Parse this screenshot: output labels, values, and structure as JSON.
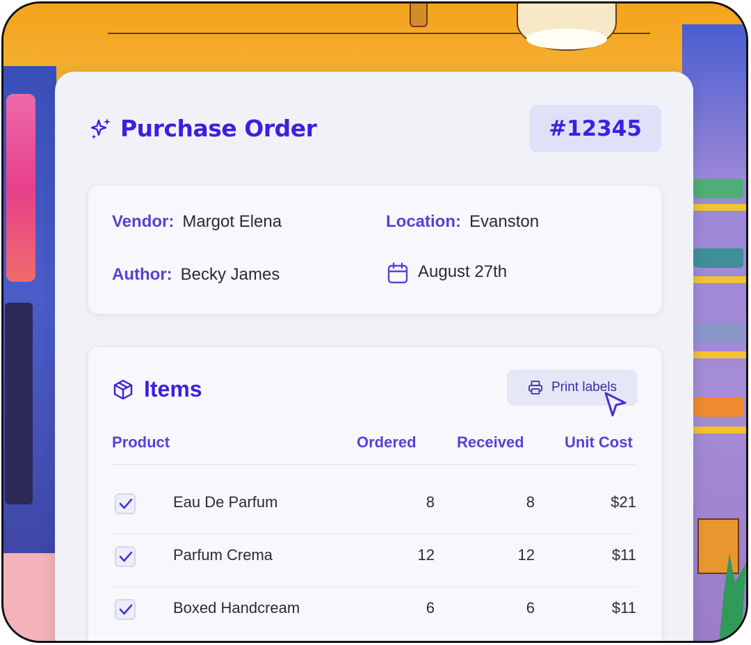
{
  "header": {
    "title": "Purchase Order",
    "order_number": "#12345"
  },
  "info": {
    "vendor_label": "Vendor:",
    "vendor_value": "Margot Elena",
    "location_label": "Location:",
    "location_value": "Evanston",
    "author_label": "Author:",
    "author_value": "Becky James",
    "date_value": "August 27th"
  },
  "items": {
    "title": "Items",
    "print_label": "Print labels",
    "columns": [
      "Product",
      "Ordered",
      "Received",
      "Unit Cost"
    ],
    "rows": [
      {
        "checked": true,
        "product": "Eau De Parfum",
        "ordered": "8",
        "received": "8",
        "unit_cost": "$21"
      },
      {
        "checked": true,
        "product": "Parfum Crema",
        "ordered": "12",
        "received": "12",
        "unit_cost": "$11"
      },
      {
        "checked": true,
        "product": "Boxed Handcream",
        "ordered": "6",
        "received": "6",
        "unit_cost": "$11"
      }
    ]
  },
  "colors": {
    "accent": "#3d1fe0",
    "label": "#5b3fd6",
    "card_bg": "#f1f2f8",
    "badge_bg": "#dfe1f8"
  },
  "icons": {
    "title": "sparkle-icon",
    "date": "calendar-icon",
    "items": "box-icon",
    "print": "printer-icon",
    "pointer": "cursor-icon",
    "check": "checkmark-icon"
  }
}
